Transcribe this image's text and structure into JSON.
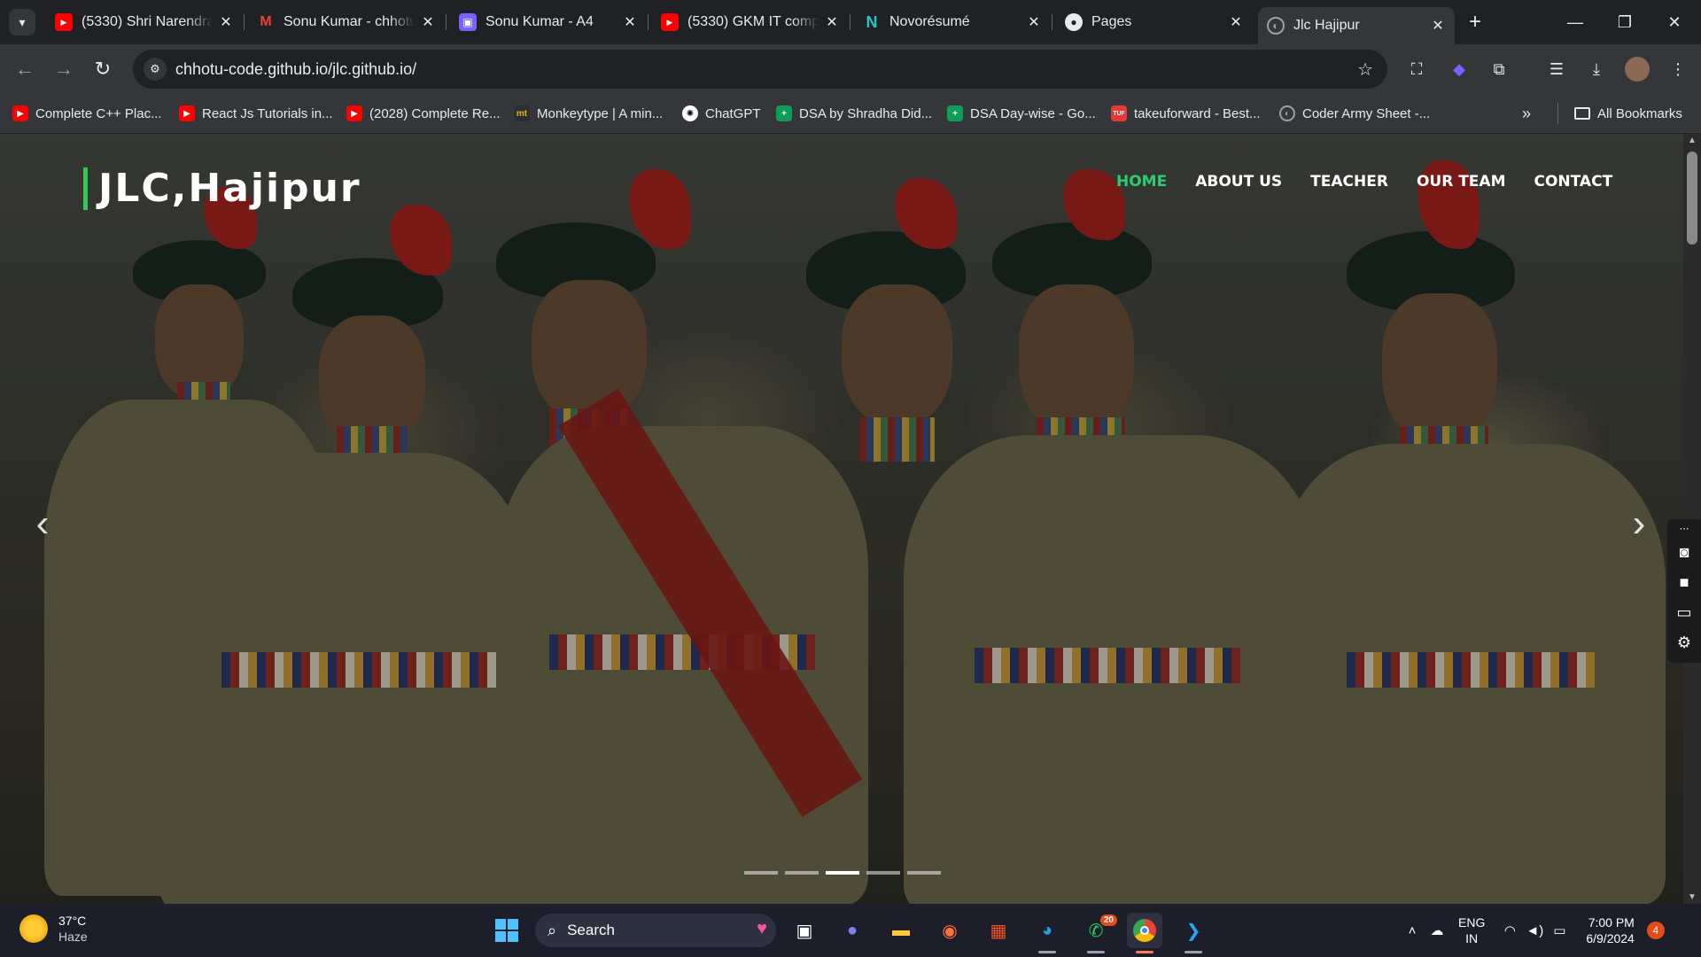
{
  "browser": {
    "tabs": [
      {
        "title": "(5330) Shri Narendra",
        "favicon": "youtube-icon"
      },
      {
        "title": "Sonu Kumar - chhotu",
        "favicon": "gmail-icon"
      },
      {
        "title": "Sonu Kumar - A4",
        "favicon": "document-icon"
      },
      {
        "title": "(5330) GKM IT comp",
        "favicon": "youtube-icon"
      },
      {
        "title": "Novorésumé",
        "favicon": "novoresume-icon"
      },
      {
        "title": "Pages",
        "favicon": "github-icon"
      },
      {
        "title": "Jlc Hajipur",
        "favicon": "globe-icon",
        "active": true
      }
    ],
    "url": "chhotu-code.github.io/jlc.github.io/",
    "bookmarks": [
      {
        "label": "Complete C++ Plac...",
        "icon": "youtube-icon"
      },
      {
        "label": "React Js Tutorials in...",
        "icon": "youtube-icon"
      },
      {
        "label": "(2028) Complete Re...",
        "icon": "youtube-icon"
      },
      {
        "label": "Monkeytype | A min...",
        "icon": "monkeytype-icon"
      },
      {
        "label": "ChatGPT",
        "icon": "chatgpt-icon"
      },
      {
        "label": "DSA by Shradha Did...",
        "icon": "sheet-icon"
      },
      {
        "label": "DSA Day-wise - Go...",
        "icon": "sheet-icon"
      },
      {
        "label": "takeuforward - Best...",
        "icon": "tuf-icon"
      },
      {
        "label": "Coder Army Sheet -...",
        "icon": "globe-icon"
      }
    ],
    "all_bookmarks": "All Bookmarks"
  },
  "site": {
    "logo": "JLC,Hajipur",
    "nav": [
      "HOME",
      "ABOUT US",
      "TEACHER",
      "OUR TEAM",
      "CONTACT"
    ],
    "active_nav": "HOME",
    "carousel": {
      "slide_count": 5,
      "active_index": 2
    }
  },
  "taskbar": {
    "weather_temp": "37°C",
    "weather_cond": "Haze",
    "search_label": "Search",
    "whatsapp_badge": "20",
    "lang_top": "ENG",
    "lang_bottom": "IN",
    "time": "7:00 PM",
    "date": "6/9/2024",
    "notifications": "4"
  },
  "colors": {
    "accent_green": "#2ecc71",
    "chrome_bg": "#202124"
  }
}
